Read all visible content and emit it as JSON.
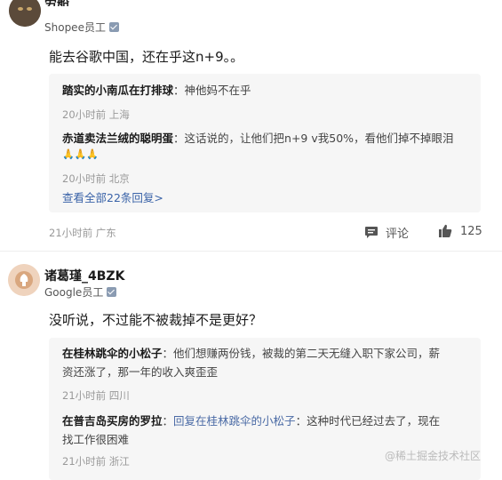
{
  "comments": [
    {
      "name": "劳船",
      "org": "Shopee员工",
      "content": "能去谷歌中国，还在乎这n+9。。",
      "replies": [
        {
          "author": "踏实的小南瓜在打排球",
          "text": "神他妈不在乎",
          "meta": "20小时前 上海"
        },
        {
          "author": "赤道卖法兰绒的聪明蛋",
          "text": "这话说的，让他们把n+9 v我50%，看他们掉不掉眼泪",
          "emoji": "🙏🙏🙏",
          "meta": "20小时前 北京"
        }
      ],
      "more": "查看全部22条回复>",
      "meta": "21小时前 广东",
      "comment_label": "评论",
      "like_count": "125"
    },
    {
      "name": "诸葛瑾_4BZK",
      "org": "Google员工",
      "content": "没听说，不过能不被裁掉不是更好？",
      "replies": [
        {
          "author": "在桂林跳伞的小松子",
          "text_line1": "他们想赚两份钱，被裁的第二天无缝入职下家公司，薪",
          "text_line2": "资还涨了，那一年的收入爽歪歪",
          "meta": "21小时前 四川"
        },
        {
          "author": "在普吉岛买房的罗拉",
          "reply_prefix": "回复",
          "reply_to": "在桂林跳伞的小松子",
          "text_line1": "这种时代已经过去了，现在",
          "text_line2": "找工作很困难",
          "meta": "21小时前 浙江"
        }
      ]
    }
  ],
  "watermark": "@稀土掘金技术社区",
  "colors": {
    "link": "#3a63a8",
    "reply_bg": "#f6f6f6",
    "meta": "#999999"
  }
}
